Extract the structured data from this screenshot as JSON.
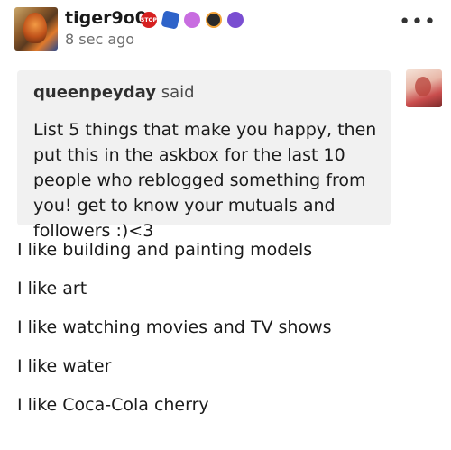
{
  "post": {
    "author": "tiger9o0",
    "timestamp": "8 sec ago",
    "badges": [
      "red-stop-badge",
      "blue-fish-badge",
      "pink-heart-badge",
      "orange-paw-badge",
      "purple-cat-badge"
    ],
    "more_icon": "•••"
  },
  "quote": {
    "quoted_user": "queenpeyday",
    "said_label": "said",
    "text": "List 5 things that make you happy, then put this in the askbox for the last 10 people who reblogged something from you! get to know your mutuals and followers :)<3"
  },
  "answers": [
    "I like building and painting models",
    "I like art",
    "I like watching movies and TV shows",
    "I like water",
    "I like Coca-Cola cherry"
  ],
  "colors": {
    "quote_bg": "#f1f1f1",
    "timestamp": "#6e6e6e",
    "text": "#1a1a1a"
  }
}
